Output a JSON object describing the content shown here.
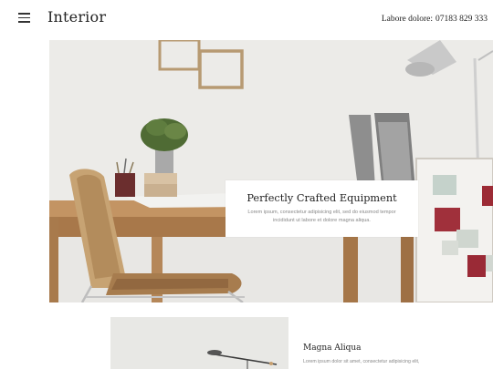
{
  "header": {
    "brand": "Interior",
    "phone_label": "Labore dolore:",
    "phone_number": "07183 829 333"
  },
  "hero": {
    "title": "Perfectly Crafted Equipment",
    "text": "Lorem ipsum, consectetur adipisicing elit, sed do eiusmod tempor incididunt ut labore et dolore magna aliqua."
  },
  "feature": {
    "title": "Magna Aliqua",
    "text": "Lorem ipsum dolor sit amet, consectetur adipisicing elit,"
  },
  "icons": {
    "menu": "hamburger-menu-icon"
  }
}
